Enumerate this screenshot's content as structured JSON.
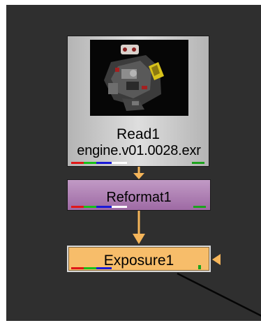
{
  "colors": {
    "canvas": "#2f2f2f",
    "pipe": "#f5b55a",
    "read_node": "#d0d0d0",
    "reformat_node": "#b07db5",
    "exposure_node": "#f7bd6a",
    "channel_red": "#e01818",
    "channel_green": "#19c019",
    "channel_blue": "#1a1ad8",
    "channel_alpha": "#ffffff",
    "mask_indicator": "#1da31d"
  },
  "nodes": {
    "read": {
      "title": "Read1",
      "file": "engine.v01.0028.exr",
      "thumbnail": "engine render thumbnail"
    },
    "reformat": {
      "title": "Reformat1"
    },
    "exposure": {
      "title": "Exposure1"
    }
  },
  "icons": {
    "input_arrow": "triangle-left-icon",
    "pipe_arrow": "arrow-down-icon"
  }
}
